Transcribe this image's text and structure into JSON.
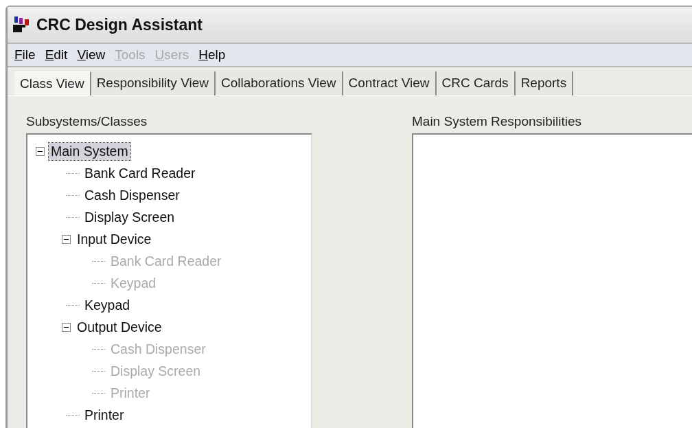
{
  "window": {
    "title": "CRC Design Assistant"
  },
  "menu": [
    {
      "label": "File",
      "disabled": false
    },
    {
      "label": "Edit",
      "disabled": false
    },
    {
      "label": "View",
      "disabled": false
    },
    {
      "label": "Tools",
      "disabled": true
    },
    {
      "label": "Users",
      "disabled": true
    },
    {
      "label": "Help",
      "disabled": false
    }
  ],
  "tabs": [
    {
      "label": "Class View",
      "selected": true
    },
    {
      "label": "Responsibility View",
      "selected": false
    },
    {
      "label": "Collaborations View",
      "selected": false
    },
    {
      "label": "Contract View",
      "selected": false
    },
    {
      "label": "CRC Cards",
      "selected": false
    },
    {
      "label": "Reports",
      "selected": false
    }
  ],
  "tree": {
    "label": "Subsystems/Classes",
    "items": [
      {
        "label": "Main System",
        "selected": true,
        "disabled": false,
        "expanded": true,
        "children": [
          {
            "label": "Bank Card Reader",
            "selected": false,
            "disabled": false
          },
          {
            "label": "Cash Dispenser",
            "selected": false,
            "disabled": false
          },
          {
            "label": "Display Screen",
            "selected": false,
            "disabled": false
          },
          {
            "label": "Input Device",
            "selected": false,
            "disabled": false,
            "expanded": true,
            "children": [
              {
                "label": "Bank Card Reader",
                "selected": false,
                "disabled": true
              },
              {
                "label": "Keypad",
                "selected": false,
                "disabled": true
              }
            ]
          },
          {
            "label": "Keypad",
            "selected": false,
            "disabled": false
          },
          {
            "label": "Output Device",
            "selected": false,
            "disabled": false,
            "expanded": true,
            "children": [
              {
                "label": "Cash Dispenser",
                "selected": false,
                "disabled": true
              },
              {
                "label": "Display Screen",
                "selected": false,
                "disabled": true
              },
              {
                "label": "Printer",
                "selected": false,
                "disabled": true
              }
            ]
          },
          {
            "label": "Printer",
            "selected": false,
            "disabled": false
          }
        ]
      }
    ]
  },
  "responsibilities": {
    "label": "Main System Responsibilities"
  }
}
